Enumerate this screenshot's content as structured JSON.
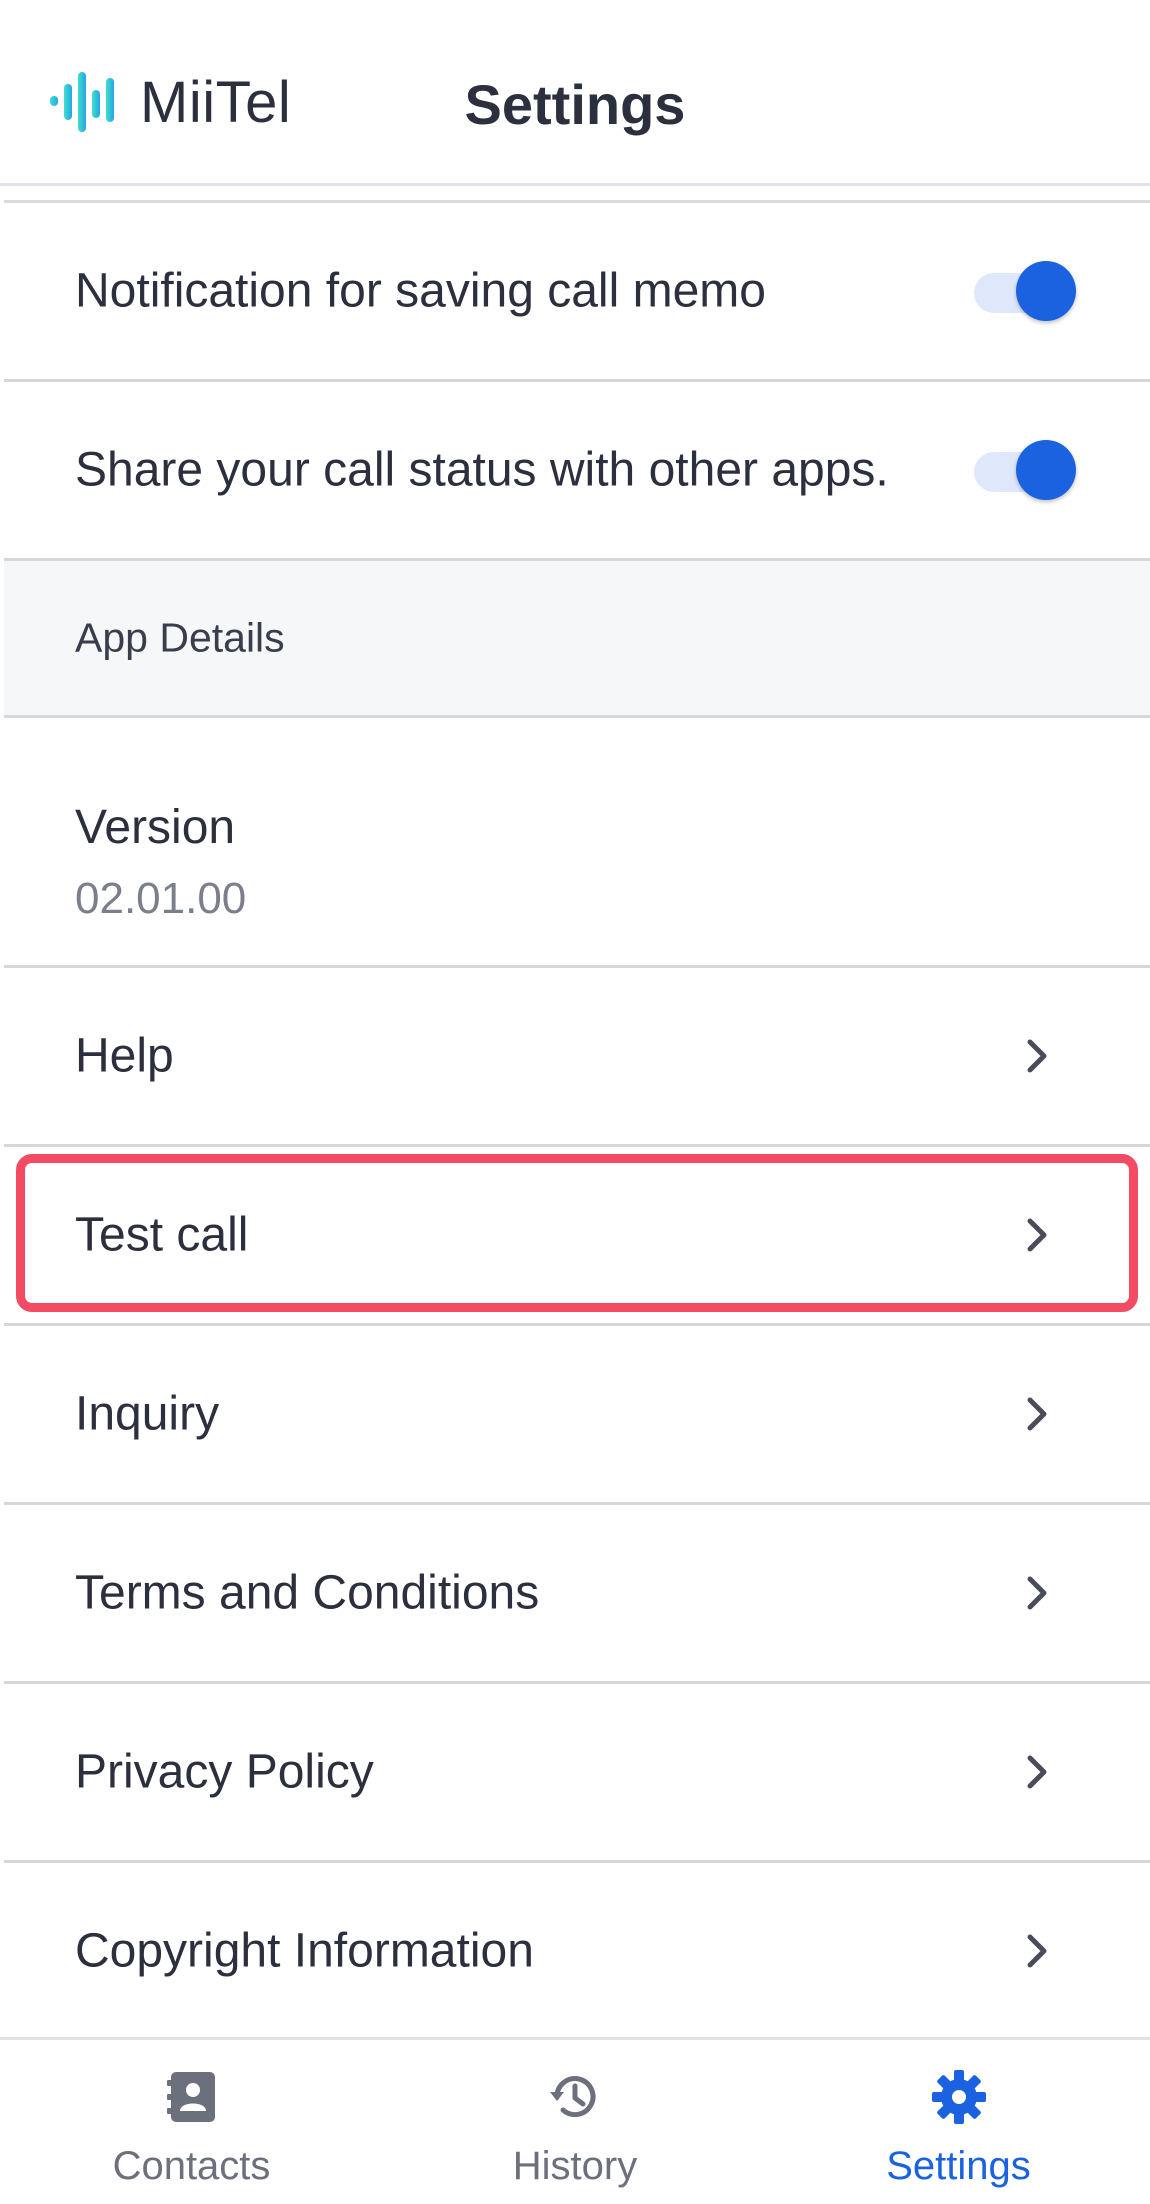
{
  "header": {
    "logo_text": "MiiTel",
    "title": "Settings"
  },
  "settings": {
    "toggles": [
      {
        "label": "Notification for saving call memo",
        "enabled": true
      },
      {
        "label": "Share your call status with other apps.",
        "enabled": true
      }
    ],
    "section_title": "App Details",
    "version": {
      "label": "Version",
      "value": "02.01.00"
    },
    "links": [
      {
        "label": "Help",
        "icon": "chevron-right-icon"
      },
      {
        "label": "Test call",
        "icon": "chevron-right-icon",
        "highlighted": true
      },
      {
        "label": "Inquiry",
        "icon": "chevron-right-icon"
      },
      {
        "label": "Terms and Conditions",
        "icon": "chevron-right-icon"
      },
      {
        "label": "Privacy Policy",
        "icon": "chevron-right-icon"
      },
      {
        "label": "Copyright Information",
        "icon": "chevron-right-icon"
      }
    ]
  },
  "bottom_nav": {
    "items": [
      {
        "label": "Contacts",
        "icon": "contacts-icon",
        "active": false
      },
      {
        "label": "History",
        "icon": "history-icon",
        "active": false
      },
      {
        "label": "Settings",
        "icon": "gear-icon",
        "active": true
      }
    ]
  },
  "colors": {
    "accent": "#1a62e0",
    "highlight": "#f24b63",
    "text": "#2c2f3e",
    "muted": "#6c707d"
  }
}
